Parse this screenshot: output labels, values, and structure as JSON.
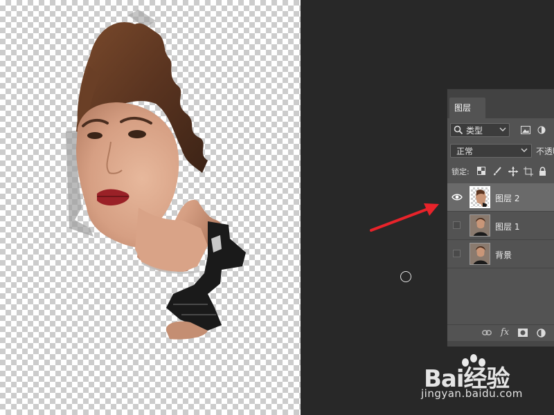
{
  "layers_panel": {
    "tab_title": "图层",
    "filter_label": "类型",
    "blend_mode": "正常",
    "opacity_label": "不透明度:",
    "lock_label": "锁定:",
    "layers": [
      {
        "name": "图层 2",
        "visible": true,
        "selected": true,
        "thumbnail": "transparent-portrait"
      },
      {
        "name": "图层 1",
        "visible": false,
        "selected": false,
        "thumbnail": "photo-portrait"
      },
      {
        "name": "背景",
        "visible": false,
        "selected": false,
        "thumbnail": "photo-portrait"
      }
    ],
    "footer_icons": [
      "link-icon",
      "fx-icon",
      "mask-icon",
      "adjustment-icon"
    ],
    "fx_label": "fx"
  },
  "canvas": {
    "content": "cut-out portrait on transparent background",
    "cursor": "brush-circle-cursor"
  },
  "annotation": {
    "arrow_color": "#e8232a"
  },
  "watermark": {
    "logo": "Bai经验",
    "url": "jingyan.baidu.com"
  },
  "colors": {
    "workspace": "#282828",
    "panel": "#535353",
    "selected_row": "#6a6a6a",
    "arrow": "#e8232a"
  }
}
